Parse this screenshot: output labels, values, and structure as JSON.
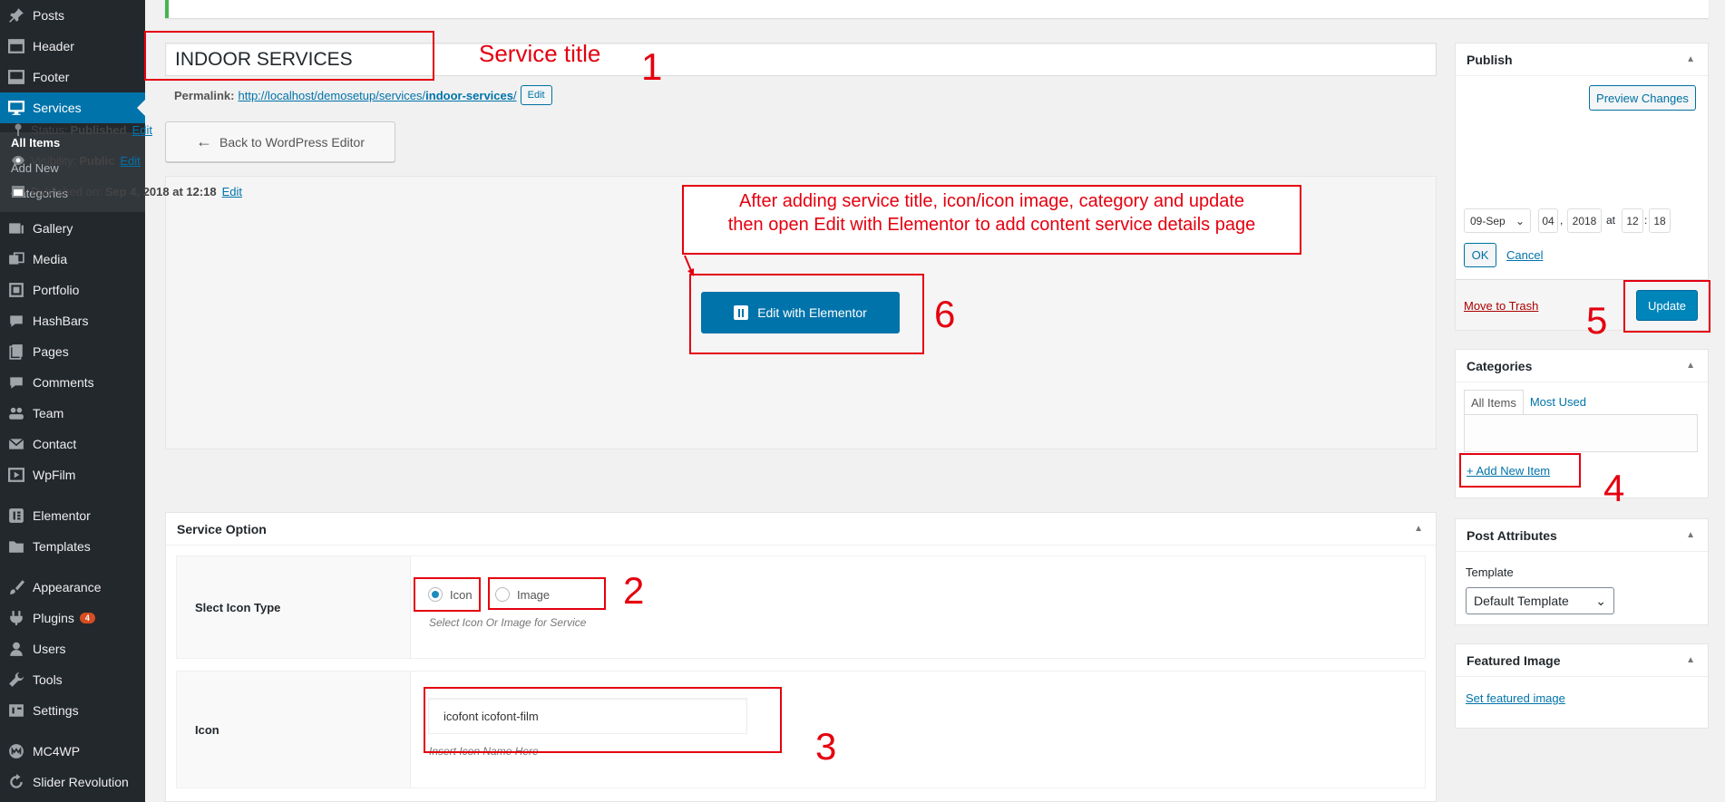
{
  "sidebar": {
    "items": [
      {
        "label": "Posts",
        "icon": "pin-icon"
      },
      {
        "label": "Header",
        "icon": "layout-icon"
      },
      {
        "label": "Footer",
        "icon": "layout-icon"
      },
      {
        "label": "Services",
        "icon": "desktop-icon"
      },
      {
        "label": "Gallery",
        "icon": "gallery-icon"
      },
      {
        "label": "Media",
        "icon": "media-icon"
      },
      {
        "label": "Portfolio",
        "icon": "portfolio-icon"
      },
      {
        "label": "HashBars",
        "icon": "comment-icon"
      },
      {
        "label": "Pages",
        "icon": "pages-icon"
      },
      {
        "label": "Comments",
        "icon": "comment-icon"
      },
      {
        "label": "Team",
        "icon": "team-icon"
      },
      {
        "label": "Contact",
        "icon": "mail-icon"
      },
      {
        "label": "WpFilm",
        "icon": "video-icon"
      },
      {
        "label": "Elementor",
        "icon": "elementor-icon"
      },
      {
        "label": "Templates",
        "icon": "folder-icon"
      },
      {
        "label": "Appearance",
        "icon": "brush-icon"
      },
      {
        "label": "Plugins",
        "icon": "plug-icon",
        "badge": "4"
      },
      {
        "label": "Users",
        "icon": "user-icon"
      },
      {
        "label": "Tools",
        "icon": "wrench-icon"
      },
      {
        "label": "Settings",
        "icon": "settings-icon"
      },
      {
        "label": "MC4WP",
        "icon": "mc4wp-icon"
      },
      {
        "label": "Slider Revolution",
        "icon": "refresh-icon"
      }
    ],
    "submenu": [
      "All Items",
      "Add New",
      "Categories"
    ]
  },
  "editor": {
    "title_value": "INDOOR SERVICES",
    "permalink_label": "Permalink:",
    "permalink_base": "http://localhost/demosetup/services/",
    "permalink_slug": "indoor-services",
    "permalink_end": "/",
    "permalink_edit": "Edit",
    "back_button": "Back to WordPress Editor",
    "elementor_button": "Edit with Elementor"
  },
  "service_option": {
    "title": "Service Option",
    "icon_type_label": "Slect Icon Type",
    "radio_icon": "Icon",
    "radio_image": "Image",
    "selected": "Icon",
    "icon_type_desc": "Select Icon Or Image for Service",
    "icon_label": "Icon",
    "icon_value": "icofont icofont-film",
    "icon_desc": "Insert Icon Name Here"
  },
  "publish": {
    "title": "Publish",
    "preview_button": "Preview Changes",
    "status_label": "Status:",
    "status_value": "Published",
    "visibility_label": "Visibility:",
    "visibility_value": "Public",
    "published_label": "Published on:",
    "published_value": "Sep 4, 2018 at 12:18",
    "edit_link": "Edit",
    "month": "09-Sep",
    "day": "04",
    "year": "2018",
    "at": "at",
    "hour": "12",
    "minute": "18",
    "comma": ",",
    "colon": ":",
    "ok_button": "OK",
    "cancel_link": "Cancel",
    "trash_link": "Move to Trash",
    "update_button": "Update"
  },
  "categories": {
    "title": "Categories",
    "tab_all": "All Items",
    "tab_most_used": "Most Used",
    "add_new": "+ Add New Item"
  },
  "post_attributes": {
    "title": "Post Attributes",
    "template_label": "Template",
    "template_value": "Default Template"
  },
  "featured_image": {
    "title": "Featured Image",
    "set_link": "Set featured image"
  },
  "annotations": {
    "service_title": "Service title",
    "n1": "1",
    "n2": "2",
    "n3": "3",
    "n4": "4",
    "n5": "5",
    "n6": "6",
    "note_line1": "After adding service title, icon/icon image, category  and update",
    "note_line2": "then open Edit with Elementor to add content service details page"
  },
  "colors": {
    "sidebar_bg": "#23282d",
    "active_blue": "#0073aa",
    "annotation_red": "#e4000f"
  }
}
